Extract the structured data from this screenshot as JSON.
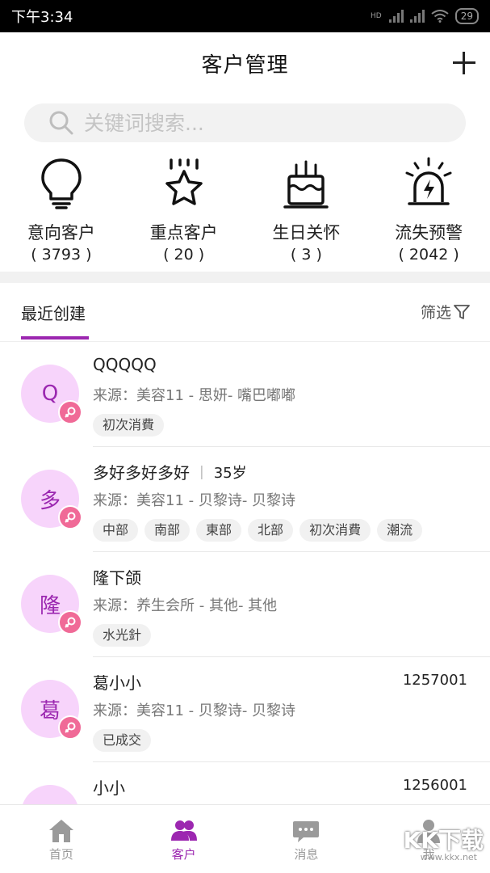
{
  "status": {
    "time": "下午3:34",
    "battery": "29",
    "network_label": "HD"
  },
  "header": {
    "title": "客户管理"
  },
  "search": {
    "placeholder": "关键词搜索..."
  },
  "categories": [
    {
      "label": "意向客户",
      "count": "( 3793 )",
      "icon": "lightbulb-icon"
    },
    {
      "label": "重点客户",
      "count": "( 20 )",
      "icon": "star-icon"
    },
    {
      "label": "生日关怀",
      "count": "( 3 )",
      "icon": "cake-icon"
    },
    {
      "label": "流失预警",
      "count": "( 2042 )",
      "icon": "alarm-icon"
    }
  ],
  "tabs": {
    "recent": "最近创建",
    "filter": "筛选"
  },
  "customers": [
    {
      "avatar": "Q",
      "name": "QQQQQ",
      "age": "",
      "number": "",
      "source": "来源：美容11 - 思妍- 嘴巴嘟嘟",
      "tags": [
        "初次消費"
      ]
    },
    {
      "avatar": "多",
      "name": "多好多好多好",
      "age": "35岁",
      "number": "",
      "source": "来源：美容11 - 贝黎诗- 贝黎诗",
      "tags": [
        "中部",
        "南部",
        "東部",
        "北部",
        "初次消費",
        "潮流"
      ]
    },
    {
      "avatar": "隆",
      "name": "隆下颌",
      "age": "",
      "number": "",
      "source": "来源：养生会所 - 其他- 其他",
      "tags": [
        "水光針"
      ]
    },
    {
      "avatar": "葛",
      "name": "葛小小",
      "age": "",
      "number": "1257001",
      "source": "来源：美容11 - 贝黎诗- 贝黎诗",
      "tags": [
        "已成交"
      ]
    },
    {
      "avatar": "小",
      "name": "小小",
      "age": "",
      "number": "1256001",
      "source": "",
      "tags": []
    }
  ],
  "bottom_nav": [
    {
      "label": "首页",
      "icon": "home-icon",
      "active": false
    },
    {
      "label": "客户",
      "icon": "customers-icon",
      "active": true
    },
    {
      "label": "消息",
      "icon": "message-icon",
      "active": false
    },
    {
      "label": "我",
      "icon": "profile-icon",
      "active": false
    }
  ],
  "watermark": {
    "main": "KK下载",
    "url": "www.kkx.net"
  },
  "colors": {
    "accent": "#9c27b0",
    "avatar_bg": "#f7d4fb",
    "gender_badge": "#f06a97"
  }
}
